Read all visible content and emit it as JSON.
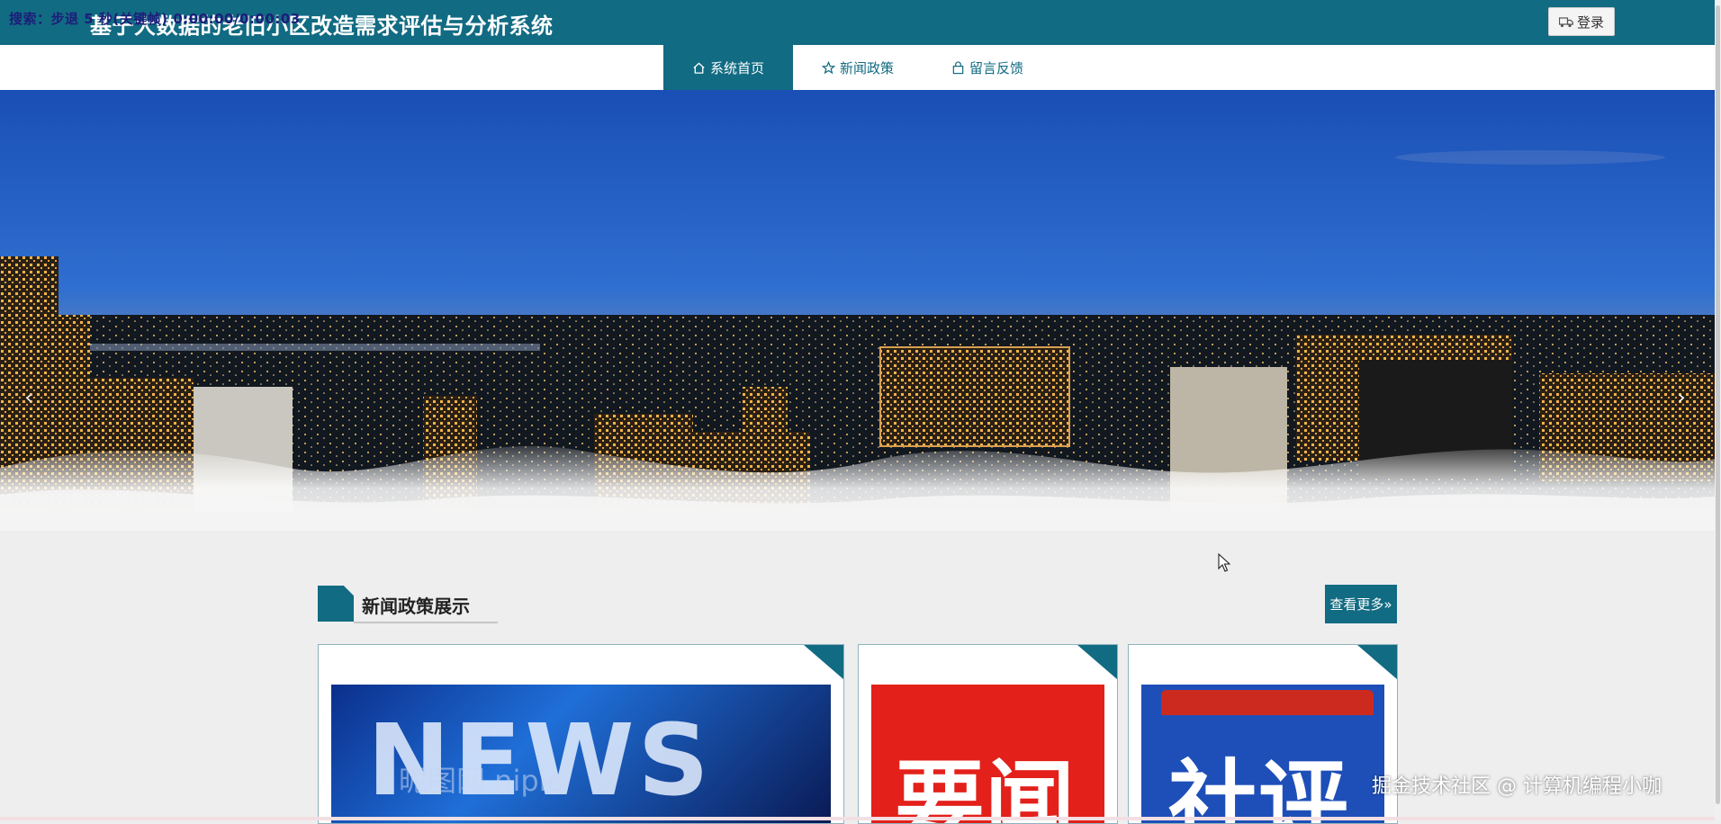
{
  "header": {
    "title": "基于大数据的老旧小区改造需求评估与分析系统",
    "overlay_text": "搜索：步退 5 秒(关键帧) 0:00:00/0:00:03",
    "login_label": "登录",
    "login_icon": "truck-icon"
  },
  "nav": {
    "items": [
      {
        "label": "系统首页",
        "icon": "home-icon",
        "active": true
      },
      {
        "label": "新闻政策",
        "icon": "star-icon",
        "active": false
      },
      {
        "label": "留言反馈",
        "icon": "bag-icon",
        "active": false
      }
    ]
  },
  "banner": {
    "prev_arrow": "‹",
    "next_arrow": "›"
  },
  "section": {
    "title": "新闻政策展示",
    "more_label": "查看更多»"
  },
  "cards": [
    {
      "image_text": "NEWS",
      "image_subtext": "昵图网 nipic"
    },
    {
      "image_text": "要闻"
    },
    {
      "image_text": "社评"
    }
  ],
  "watermark": "掘金技术社区 @ 计算机编程小咖",
  "colors": {
    "primary": "#116b82",
    "background": "#eeeeee"
  }
}
